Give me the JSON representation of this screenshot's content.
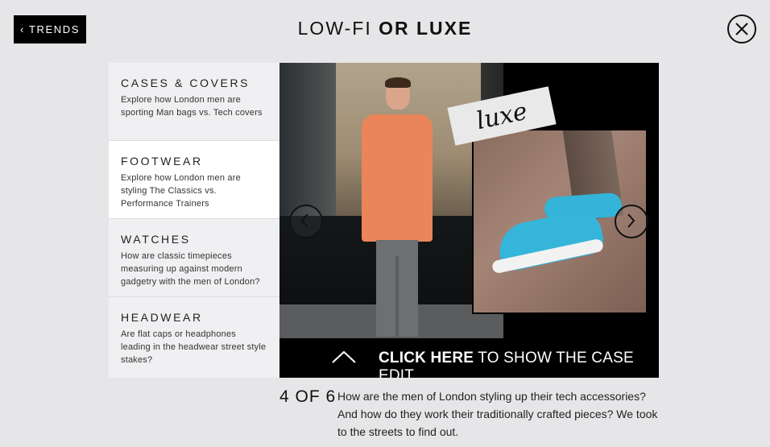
{
  "header": {
    "back_label": "TRENDS",
    "title_light": "LOW-FI",
    "title_bold": "OR LUXE"
  },
  "sidebar": {
    "items": [
      {
        "title": "CASES & COVERS",
        "desc": "Explore how London men are sporting Man bags vs. Tech covers",
        "active": false
      },
      {
        "title": "FOOTWEAR",
        "desc": "Explore how London men are styling The Classics vs. Performance Trainers",
        "active": true
      },
      {
        "title": "WATCHES",
        "desc": "How are classic timepieces measuring up against modern gadgetry with the men of London?",
        "active": false
      },
      {
        "title": "HEADWEAR",
        "desc": "Are flat caps or headphones leading in the headwear street style stakes?",
        "active": false
      }
    ]
  },
  "stage": {
    "tag_label": "luxe",
    "cta_bold": "CLICK HERE",
    "cta_rest": " TO SHOW THE CASE EDIT"
  },
  "caption": {
    "counter": "4 OF 6",
    "text": "How are the men of London styling up their tech accessories? And how do they work their traditionally crafted pieces? We took to the streets to find out."
  },
  "icons": {
    "back": "chevron-left-icon",
    "close": "close-icon",
    "prev": "chevron-left-icon",
    "next": "chevron-right-icon",
    "expand": "chevron-up-icon"
  },
  "colors": {
    "page_bg": "#e6e6e8",
    "sidebar_bg": "#f0f0f2",
    "active_bg": "#ffffff",
    "accent": "#000000"
  }
}
